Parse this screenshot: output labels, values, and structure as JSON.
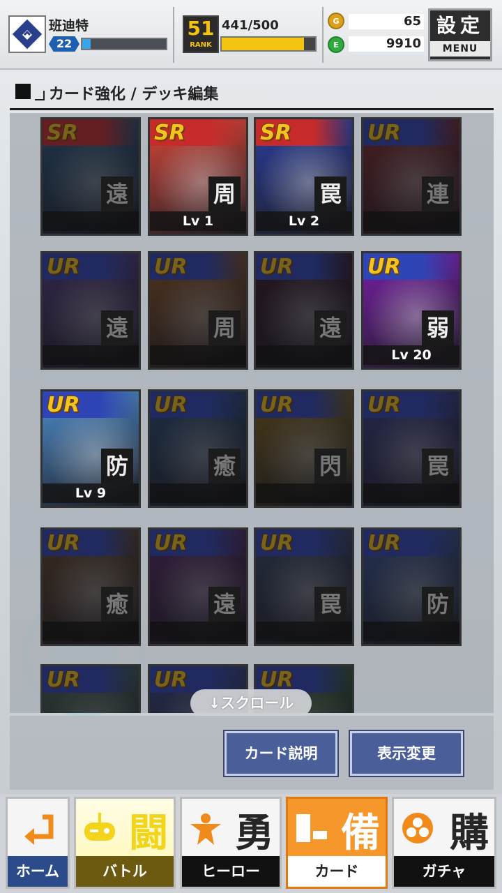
{
  "player": {
    "name": "班迪特",
    "level": "22",
    "exp_ratio": 0.1
  },
  "rank": {
    "number": "51",
    "label": "RANK",
    "stamina": "441/500",
    "stamina_ratio": 0.882
  },
  "currency": {
    "coin_icon": "coin-icon",
    "coin_symbol": "G",
    "coins": "65",
    "gem_icon": "gem-icon",
    "gem_symbol": "E",
    "gems": "9910"
  },
  "menu": {
    "kanji": "設定",
    "label": "MENU"
  },
  "section": {
    "title": "カード強化 / デッキ編集"
  },
  "cards": [
    {
      "rarity": "SR",
      "type": "遠",
      "level": "",
      "dim": true,
      "color": "#2d5f8a"
    },
    {
      "rarity": "SR",
      "type": "周",
      "level": "Lv 1",
      "dim": false,
      "color": "#d9483a"
    },
    {
      "rarity": "SR",
      "type": "罠",
      "level": "Lv 2",
      "dim": false,
      "color": "#2b3f9e"
    },
    {
      "rarity": "UR",
      "type": "連",
      "level": "",
      "dim": true,
      "color": "#8a2a2a"
    },
    {
      "rarity": "UR",
      "type": "遠",
      "level": "",
      "dim": true,
      "color": "#5a3f86"
    },
    {
      "rarity": "UR",
      "type": "周",
      "level": "",
      "dim": true,
      "color": "#9a5a22"
    },
    {
      "rarity": "UR",
      "type": "遠",
      "level": "",
      "dim": true,
      "color": "#3a1a2a"
    },
    {
      "rarity": "UR",
      "type": "弱",
      "level": "Lv 20",
      "dim": false,
      "color": "#7a1fa8"
    },
    {
      "rarity": "UR",
      "type": "防",
      "level": "Lv 9",
      "dim": false,
      "color": "#4f8fcf"
    },
    {
      "rarity": "UR",
      "type": "癒",
      "level": "",
      "dim": true,
      "color": "#2a4f7a"
    },
    {
      "rarity": "UR",
      "type": "閃",
      "level": "",
      "dim": true,
      "color": "#8a6a1a"
    },
    {
      "rarity": "UR",
      "type": "罠",
      "level": "",
      "dim": true,
      "color": "#3a3f8a"
    },
    {
      "rarity": "UR",
      "type": "癒",
      "level": "",
      "dim": true,
      "color": "#6a4a2a"
    },
    {
      "rarity": "UR",
      "type": "遠",
      "level": "",
      "dim": true,
      "color": "#5a2a6a"
    },
    {
      "rarity": "UR",
      "type": "罠",
      "level": "",
      "dim": true,
      "color": "#3a4a6a"
    },
    {
      "rarity": "UR",
      "type": "防",
      "level": "",
      "dim": true,
      "color": "#3a5a9a"
    },
    {
      "rarity": "UR",
      "type": "",
      "level": "",
      "dim": true,
      "color": "#4a6a5a"
    },
    {
      "rarity": "UR",
      "type": "",
      "level": "",
      "dim": true,
      "color": "#3a4a8a"
    },
    {
      "rarity": "UR",
      "type": "",
      "level": "",
      "dim": true,
      "color": "#3a6a3a"
    }
  ],
  "scroll_hint": "↓スクロール",
  "buttons": {
    "card_info": "カード説明",
    "view_change": "表示変更"
  },
  "nav": [
    {
      "kanji": "",
      "label": "ホーム",
      "icon": "back-arrow-icon",
      "active": false
    },
    {
      "kanji": "闘",
      "label": "バトル",
      "icon": "gamepad-icon",
      "active": false
    },
    {
      "kanji": "勇",
      "label": "ヒーロー",
      "icon": "hero-icon",
      "active": false
    },
    {
      "kanji": "備",
      "label": "カード",
      "icon": "card-icon",
      "active": true
    },
    {
      "kanji": "購",
      "label": "ガチャ",
      "icon": "gacha-icon",
      "active": false
    }
  ]
}
